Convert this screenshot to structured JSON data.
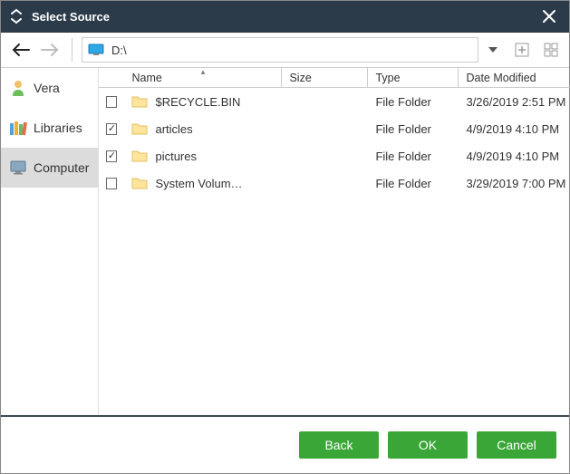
{
  "window": {
    "title": "Select Source"
  },
  "toolbar": {
    "path": "D:\\"
  },
  "sidebar": {
    "items": [
      {
        "label": "Vera",
        "icon": "user-icon",
        "selected": false
      },
      {
        "label": "Libraries",
        "icon": "libraries-icon",
        "selected": false
      },
      {
        "label": "Computer",
        "icon": "computer-icon",
        "selected": true
      }
    ]
  },
  "columns": {
    "name": "Name",
    "size": "Size",
    "type": "Type",
    "date": "Date Modified"
  },
  "rows": [
    {
      "checked": false,
      "name": "$RECYCLE.BIN",
      "size": "",
      "type": "File Folder",
      "date": "3/26/2019 2:51 PM"
    },
    {
      "checked": true,
      "name": "articles",
      "size": "",
      "type": "File Folder",
      "date": "4/9/2019 4:10 PM"
    },
    {
      "checked": true,
      "name": "pictures",
      "size": "",
      "type": "File Folder",
      "date": "4/9/2019 4:10 PM"
    },
    {
      "checked": false,
      "name": "System Volum…",
      "size": "",
      "type": "File Folder",
      "date": "3/29/2019 7:00 PM"
    }
  ],
  "footer": {
    "back": "Back",
    "ok": "OK",
    "cancel": "Cancel"
  }
}
